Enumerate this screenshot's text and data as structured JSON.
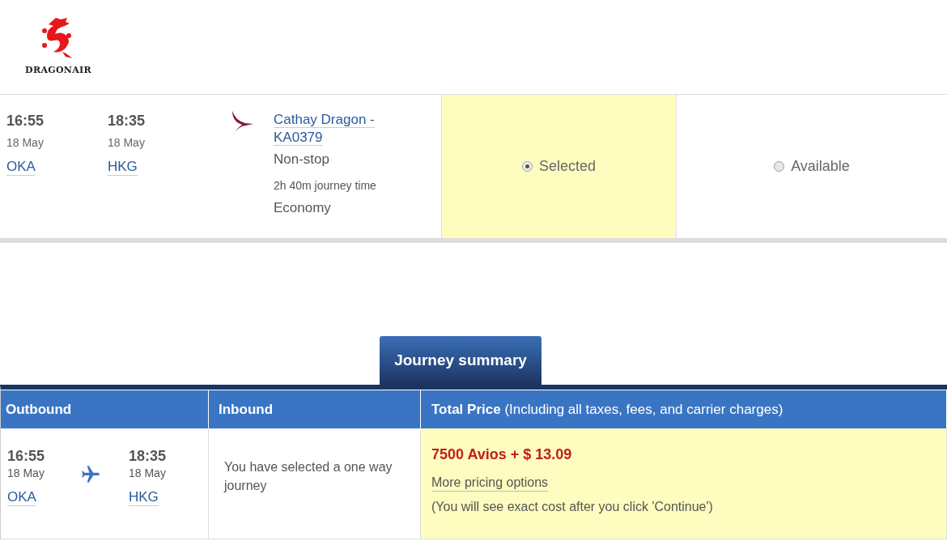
{
  "airline_logo": {
    "name": "DRAGONAIR"
  },
  "flight": {
    "departure": {
      "time": "16:55",
      "date": "18 May",
      "airport": "OKA"
    },
    "arrival": {
      "time": "18:35",
      "date": "18 May",
      "airport": "HKG"
    },
    "carrier_link": "Cathay Dragon - KA0379",
    "stops": "Non-stop",
    "duration": "2h 40m journey time",
    "cabin": "Economy",
    "fare_options": [
      {
        "label": "Selected",
        "selected": true
      },
      {
        "label": "Available",
        "selected": false
      }
    ]
  },
  "summary_tab": "Journey summary",
  "summary": {
    "columns": [
      "Outbound",
      "Inbound",
      "**Total Price** (Including all taxes, fees, and carrier charges)"
    ],
    "outbound": {
      "departure": {
        "time": "16:55",
        "date": "18 May",
        "airport": "OKA"
      },
      "arrival": {
        "time": "18:35",
        "date": "18 May",
        "airport": "HKG"
      }
    },
    "inbound_text": "You have selected a one way journey",
    "price": "7500 Avios + $ 13.09",
    "pricing_link": "More pricing options",
    "note": "(You will see exact cost after you click 'Continue')"
  }
}
